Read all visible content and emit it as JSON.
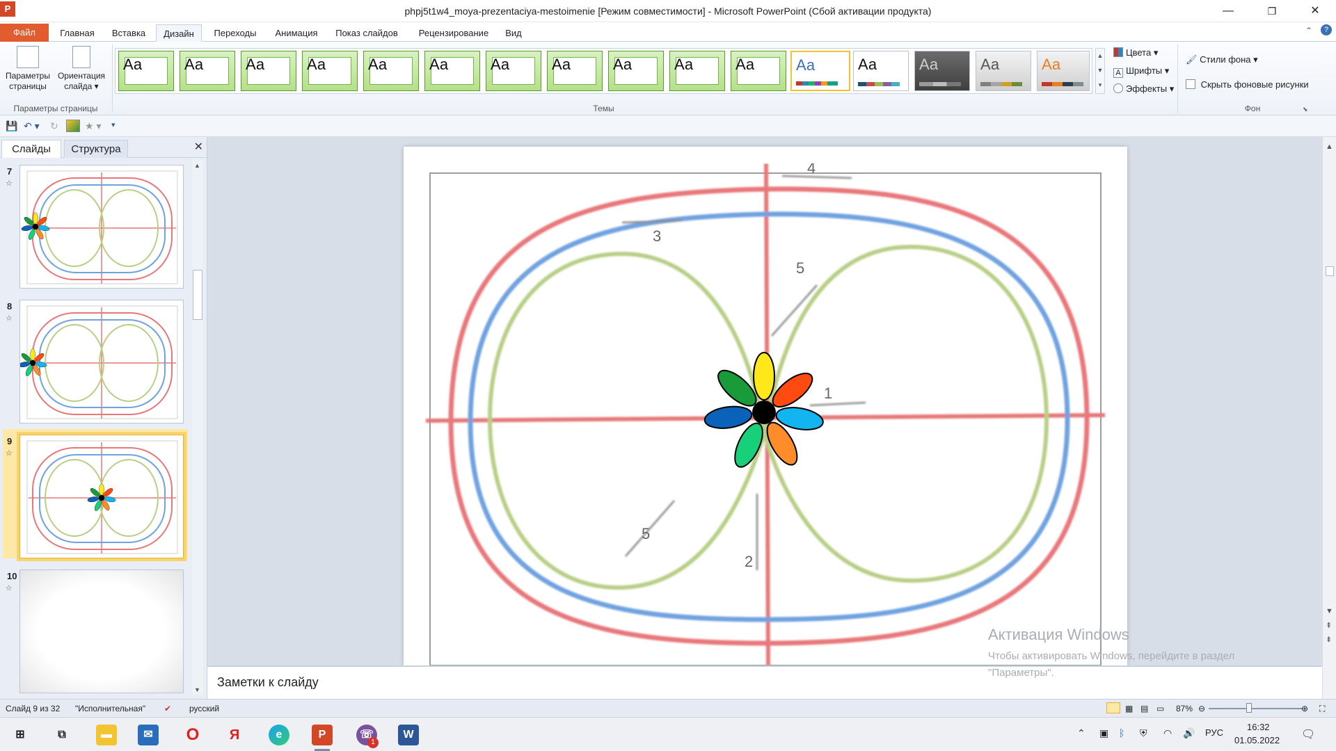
{
  "window": {
    "title": "phpj5t1w4_moya-prezentaciya-mestoimenie [Режим совместимости]  -  Microsoft PowerPoint (Сбой активации продукта)",
    "app_letter": "P",
    "minimize": "—",
    "restore": "❐",
    "close": "✕"
  },
  "ribbon_tabs": [
    "Файл",
    "Главная",
    "Вставка",
    "Дизайн",
    "Переходы",
    "Анимация",
    "Показ слайдов",
    "Рецензирование",
    "Вид"
  ],
  "active_tab": "Дизайн",
  "page_setup": {
    "params_label": "Параметры страницы",
    "orientation_label": "Ориентация слайда",
    "group_label": "Параметры страницы"
  },
  "themes": {
    "group_label": "Темы",
    "thumb_text": "Аа",
    "colors": "Цвета",
    "fonts": "Шрифты",
    "effects": "Эффекты"
  },
  "background": {
    "styles": "Стили фона",
    "hide_graphics": "Скрыть фоновые рисунки",
    "group_label": "Фон"
  },
  "slides_pane": {
    "tab_slides": "Слайды",
    "tab_outline": "Структура",
    "close": "✕",
    "thumbnails": [
      {
        "number": "7"
      },
      {
        "number": "8"
      },
      {
        "number": "9"
      },
      {
        "number": "10"
      }
    ]
  },
  "slide": {
    "labels": [
      "4",
      "3",
      "5",
      "1",
      "5",
      "2"
    ]
  },
  "notes": {
    "placeholder": "Заметки к слайду"
  },
  "activation": {
    "title": "Активация Windows",
    "line1": "Чтобы активировать Windows, перейдите в раздел",
    "line2": "\"Параметры\"."
  },
  "statusbar": {
    "slide_info": "Слайд 9 из 32",
    "theme_name": "\"Исполнительная\"",
    "language": "русский",
    "zoom": "87%"
  },
  "taskbar": {
    "lang": "РУС",
    "time": "16:32",
    "date": "01.05.2022",
    "viber_badge": "1"
  },
  "colors": {
    "accent_file_tab": "#e15c2e",
    "track_red": "#e8777a",
    "track_blue": "#6fa2e0",
    "track_green": "#b8cf85",
    "axis_red": "#e67878"
  }
}
